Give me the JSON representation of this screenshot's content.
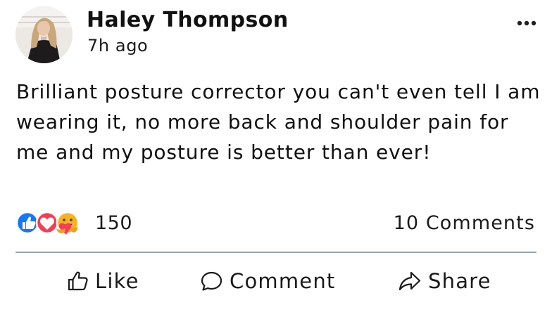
{
  "post": {
    "author": "Haley Thompson",
    "timestamp": "7h ago",
    "text": "Brilliant posture corrector you can't even tell I am wearing it, no more back and shoulder pain for me and my posture is better than ever!",
    "more_menu_icon": "more-horizontal-icon",
    "avatar": "profile-photo"
  },
  "reactions": {
    "icons": [
      "like-reaction-icon",
      "love-reaction-icon",
      "care-reaction-icon"
    ],
    "count": "150",
    "comments": "10 Comments",
    "colors": {
      "like": "#1877f2",
      "love": "#f33e58",
      "care": "#f7b125"
    }
  },
  "actions": {
    "like": {
      "label": "Like",
      "icon": "thumbs-up-icon"
    },
    "comment": {
      "label": "Comment",
      "icon": "speech-bubble-icon"
    },
    "share": {
      "label": "Share",
      "icon": "share-arrow-icon"
    }
  }
}
